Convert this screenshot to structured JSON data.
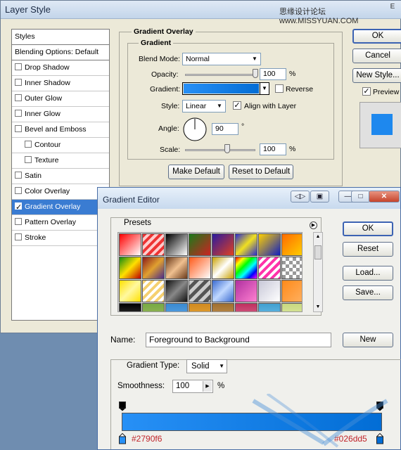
{
  "layer_style": {
    "title": "Layer Style",
    "watermark": "思缘设计论坛 www.MISSYUAN.COM",
    "close_glyph": "E",
    "left_panel": [
      {
        "label": "Styles",
        "type": "header"
      },
      {
        "label": "Blending Options: Default",
        "type": "header"
      },
      {
        "label": "Drop Shadow",
        "checked": false
      },
      {
        "label": "Inner Shadow",
        "checked": false
      },
      {
        "label": "Outer Glow",
        "checked": false
      },
      {
        "label": "Inner Glow",
        "checked": false
      },
      {
        "label": "Bevel and Emboss",
        "checked": false
      },
      {
        "label": "Contour",
        "checked": false,
        "indent": true
      },
      {
        "label": "Texture",
        "checked": false,
        "indent": true
      },
      {
        "label": "Satin",
        "checked": false
      },
      {
        "label": "Color Overlay",
        "checked": false
      },
      {
        "label": "Gradient Overlay",
        "checked": true,
        "selected": true
      },
      {
        "label": "Pattern Overlay",
        "checked": false
      },
      {
        "label": "Stroke",
        "checked": false
      }
    ],
    "section_title": "Gradient Overlay",
    "group_title": "Gradient",
    "blend_mode_label": "Blend Mode:",
    "blend_mode_value": "Normal",
    "opacity_label": "Opacity:",
    "opacity_value": "100",
    "opacity_unit": "%",
    "opacity_level": 1.0,
    "gradient_label": "Gradient:",
    "gradient_from": "#2790f6",
    "gradient_to": "#026dd5",
    "reverse_label": "Reverse",
    "reverse_checked": false,
    "style_label": "Style:",
    "style_value": "Linear",
    "align_label": "Align with Layer",
    "align_checked": true,
    "angle_label": "Angle:",
    "angle_value": "90",
    "angle_unit": "°",
    "scale_label": "Scale:",
    "scale_value": "100",
    "scale_unit": "%",
    "scale_level": 0.5,
    "make_default_label": "Make Default",
    "reset_default_label": "Reset to Default",
    "ok_label": "OK",
    "cancel_label": "Cancel",
    "new_style_label": "New Style...",
    "preview_label": "Preview",
    "preview_checked": true,
    "preview_color": "#1e88ee"
  },
  "gradient_editor": {
    "title": "Gradient Editor",
    "presets_label": "Presets",
    "ok_label": "OK",
    "reset_label": "Reset",
    "load_label": "Load...",
    "save_label": "Save...",
    "name_label": "Name:",
    "name_value": "Foreground to Background",
    "new_label": "New",
    "gradient_type_label": "Gradient Type:",
    "gradient_type_value": "Solid",
    "smoothness_label": "Smoothness:",
    "smoothness_value": "100",
    "smoothness_unit": "%",
    "stop_left_color": "#2790f6",
    "stop_right_color": "#026dd5",
    "stop_left_label": "#2790f6",
    "stop_right_label": "#026dd5",
    "swatches": [
      "linear-gradient(135deg,#ff0000,#ffffff)",
      "repeating-linear-gradient(135deg,#e33 0 4px,#fcc 4px 8px)",
      "linear-gradient(135deg,#000,#fff)",
      "linear-gradient(135deg,#1a7a1a,#c22)",
      "linear-gradient(135deg,#2a1aa0,#e04020)",
      "linear-gradient(135deg,#2a2ad0,#f0e020,#2a2ad0)",
      "linear-gradient(135deg,#ffd000,#1020c0)",
      "linear-gradient(135deg,#ff6a00,#ffd000)",
      "linear-gradient(135deg,#138a13,#ffe000,#b00)",
      "linear-gradient(135deg,#8a1a1a,#e0a030,#4a2a8a)",
      "linear-gradient(135deg,#6a3a1a,#f0c090,#6a3a1a)",
      "linear-gradient(135deg,#ff5a1a,#fff)",
      "linear-gradient(135deg,#c8a000,#fff,#c8a000)",
      "linear-gradient(135deg,#f00,#ff0,#0f0,#0ff,#00f,#f0f)",
      "repeating-linear-gradient(135deg,#f3a 0 4px,#fff 4px 8px)",
      "repeating-conic-gradient(#999 0 25%,#fff 0 50%) 0 0/10px 10px",
      "linear-gradient(135deg,#ffe000,#fff8a0,#ffe000)",
      "repeating-linear-gradient(135deg,#f5d070 0 4px,#fff 4px 8px)",
      "linear-gradient(135deg,#111,#888,#111)",
      "repeating-linear-gradient(135deg,#ccc 0 5px,#555 5px 10px)",
      "linear-gradient(135deg,#3a6ad0,#c0d8ff,#3a6ad0)",
      "linear-gradient(135deg,#b030a0,#ff80d0)",
      "linear-gradient(135deg,#c8c8d8,#fff)",
      "linear-gradient(135deg,#ff8a1a,#ffb060)",
      "linear-gradient(#000,#555)",
      "linear-gradient(#7a4,#ab6)",
      "linear-gradient(#3a8ad0,#6ab0f0)",
      "linear-gradient(#d08a20,#f0b040)",
      "linear-gradient(#a07030,#d0a060)",
      "linear-gradient(#c03060,#e080a0)",
      "linear-gradient(#40a0d0,#80c8f0)",
      "linear-gradient(#c8d880,#e8f0b0)"
    ]
  }
}
